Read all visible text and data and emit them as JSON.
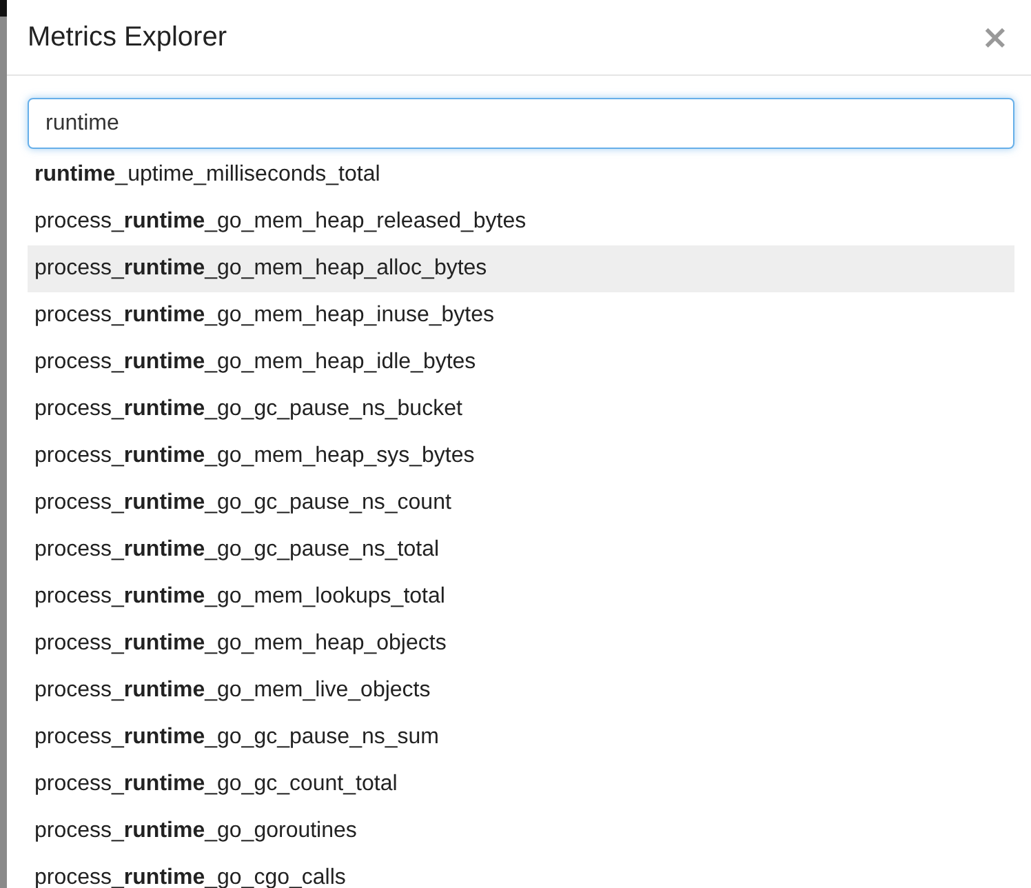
{
  "dialog": {
    "title": "Metrics Explorer",
    "close": "×"
  },
  "search": {
    "value": "runtime"
  },
  "results": [
    {
      "label": "**runtime**_uptime_milliseconds_total",
      "selected": false
    },
    {
      "label": "process_**runtime**_go_mem_heap_released_bytes",
      "selected": false
    },
    {
      "label": "process_**runtime**_go_mem_heap_alloc_bytes",
      "selected": true
    },
    {
      "label": "process_**runtime**_go_mem_heap_inuse_bytes",
      "selected": false
    },
    {
      "label": "process_**runtime**_go_mem_heap_idle_bytes",
      "selected": false
    },
    {
      "label": "process_**runtime**_go_gc_pause_ns_bucket",
      "selected": false
    },
    {
      "label": "process_**runtime**_go_mem_heap_sys_bytes",
      "selected": false
    },
    {
      "label": "process_**runtime**_go_gc_pause_ns_count",
      "selected": false
    },
    {
      "label": "process_**runtime**_go_gc_pause_ns_total",
      "selected": false
    },
    {
      "label": "process_**runtime**_go_mem_lookups_total",
      "selected": false
    },
    {
      "label": "process_**runtime**_go_mem_heap_objects",
      "selected": false
    },
    {
      "label": "process_**runtime**_go_mem_live_objects",
      "selected": false
    },
    {
      "label": "process_**runtime**_go_gc_pause_ns_sum",
      "selected": false
    },
    {
      "label": "process_**runtime**_go_gc_count_total",
      "selected": false
    },
    {
      "label": "process_**runtime**_go_goroutines",
      "selected": false
    },
    {
      "label": "process_**runtime**_go_cgo_calls",
      "selected": false
    }
  ]
}
